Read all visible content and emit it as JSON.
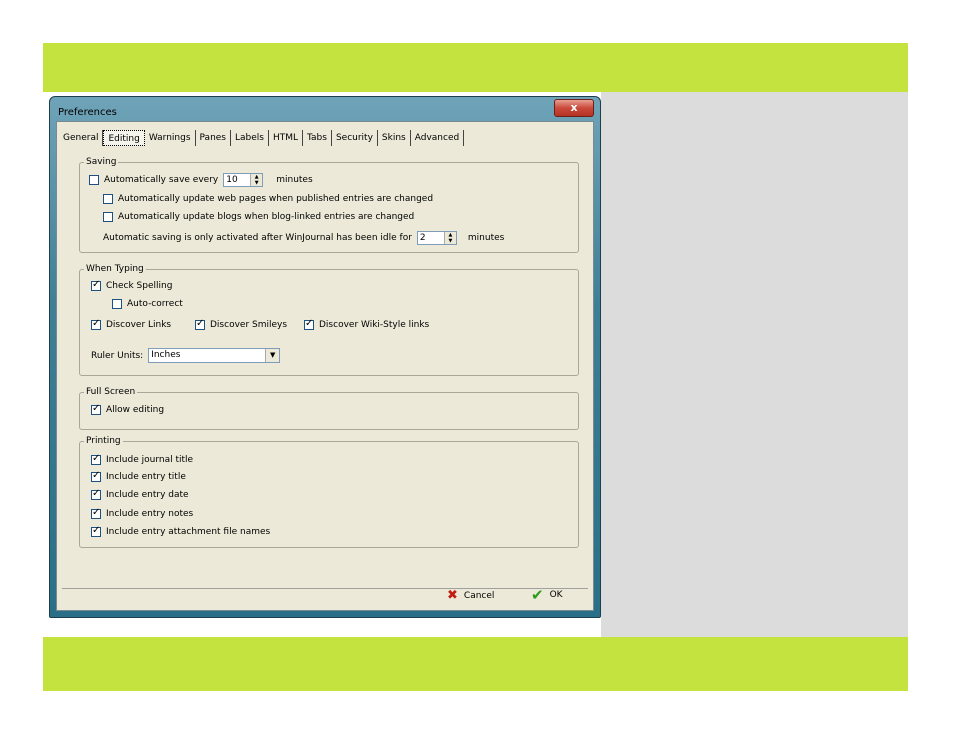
{
  "window": {
    "title": "Preferences",
    "close_glyph": "x"
  },
  "tabs": [
    {
      "label": "General"
    },
    {
      "label": "Editing"
    },
    {
      "label": "Warnings"
    },
    {
      "label": "Panes"
    },
    {
      "label": "Labels"
    },
    {
      "label": "HTML"
    },
    {
      "label": "Tabs"
    },
    {
      "label": "Security"
    },
    {
      "label": "Skins"
    },
    {
      "label": "Advanced"
    }
  ],
  "active_tab": "Editing",
  "saving": {
    "legend": "Saving",
    "auto_save_label": "Automatically save every",
    "auto_save_value": "10",
    "auto_save_unit": "minutes",
    "auto_save_checked": false,
    "update_web_label": "Automatically update web pages when published entries are changed",
    "update_web_checked": false,
    "update_blogs_label": "Automatically update blogs when blog-linked entries are changed",
    "update_blogs_checked": false,
    "idle_label": "Automatic saving  is only activated after WinJournal has been idle for",
    "idle_value": "2",
    "idle_unit": "minutes"
  },
  "typing": {
    "legend": "When Typing",
    "check_spelling_label": "Check Spelling",
    "check_spelling_checked": true,
    "autocorrect_label": "Auto-correct",
    "autocorrect_checked": false,
    "discover_links_label": "Discover Links",
    "discover_links_checked": true,
    "discover_smileys_label": "Discover Smileys",
    "discover_smileys_checked": true,
    "discover_wiki_label": "Discover Wiki-Style links",
    "discover_wiki_checked": true,
    "ruler_label": "Ruler Units:",
    "ruler_value": "Inches"
  },
  "fullscreen": {
    "legend": "Full Screen",
    "allow_editing_label": "Allow editing",
    "allow_editing_checked": true
  },
  "printing": {
    "legend": "Printing",
    "items": [
      {
        "label": "Include journal title",
        "checked": true
      },
      {
        "label": "Include entry title",
        "checked": true
      },
      {
        "label": "Include entry date",
        "checked": true
      },
      {
        "label": "Include entry notes",
        "checked": true
      },
      {
        "label": "Include entry attachment file names",
        "checked": true
      }
    ]
  },
  "buttons": {
    "cancel_label": "Cancel",
    "ok_label": "OK"
  },
  "colors": {
    "band": "#c5e33f",
    "panel_gray": "#dcdcdc",
    "dialog_face": "#ece9d8"
  }
}
